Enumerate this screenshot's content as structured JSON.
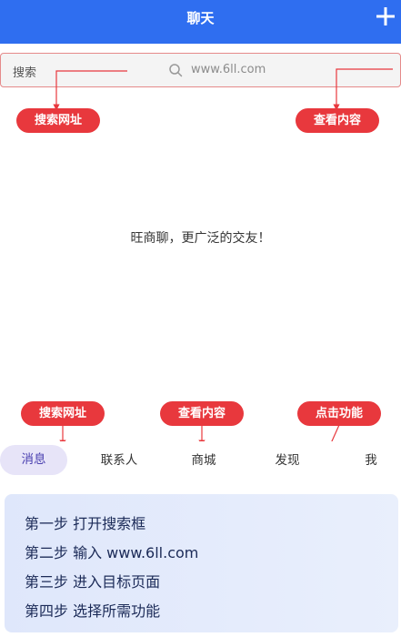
{
  "header": {
    "title": "聊天",
    "plus_icon": "plus-icon"
  },
  "search": {
    "label": "搜索",
    "url": "www.6ll.com",
    "icon": "search-icon"
  },
  "callouts": {
    "search_url": "搜索网址",
    "view_content": "查看内容",
    "click_function": "点击功能"
  },
  "main": {
    "welcome_text": "旺商聊，更广泛的交友！"
  },
  "tabs": [
    {
      "label": "消息",
      "active": true
    },
    {
      "label": "联系人",
      "active": false
    },
    {
      "label": "商城",
      "active": false
    },
    {
      "label": "发现",
      "active": false
    },
    {
      "label": "我",
      "active": false
    }
  ],
  "steps": [
    "第一步 打开搜索框",
    "第二步 输入 www.6ll.com",
    "第三步 进入目标页面",
    "第四步 选择所需功能"
  ],
  "colors": {
    "header_bg": "#2f6ef0",
    "callout_red": "#e8383d",
    "active_tab_bg": "#e7e4f8"
  }
}
